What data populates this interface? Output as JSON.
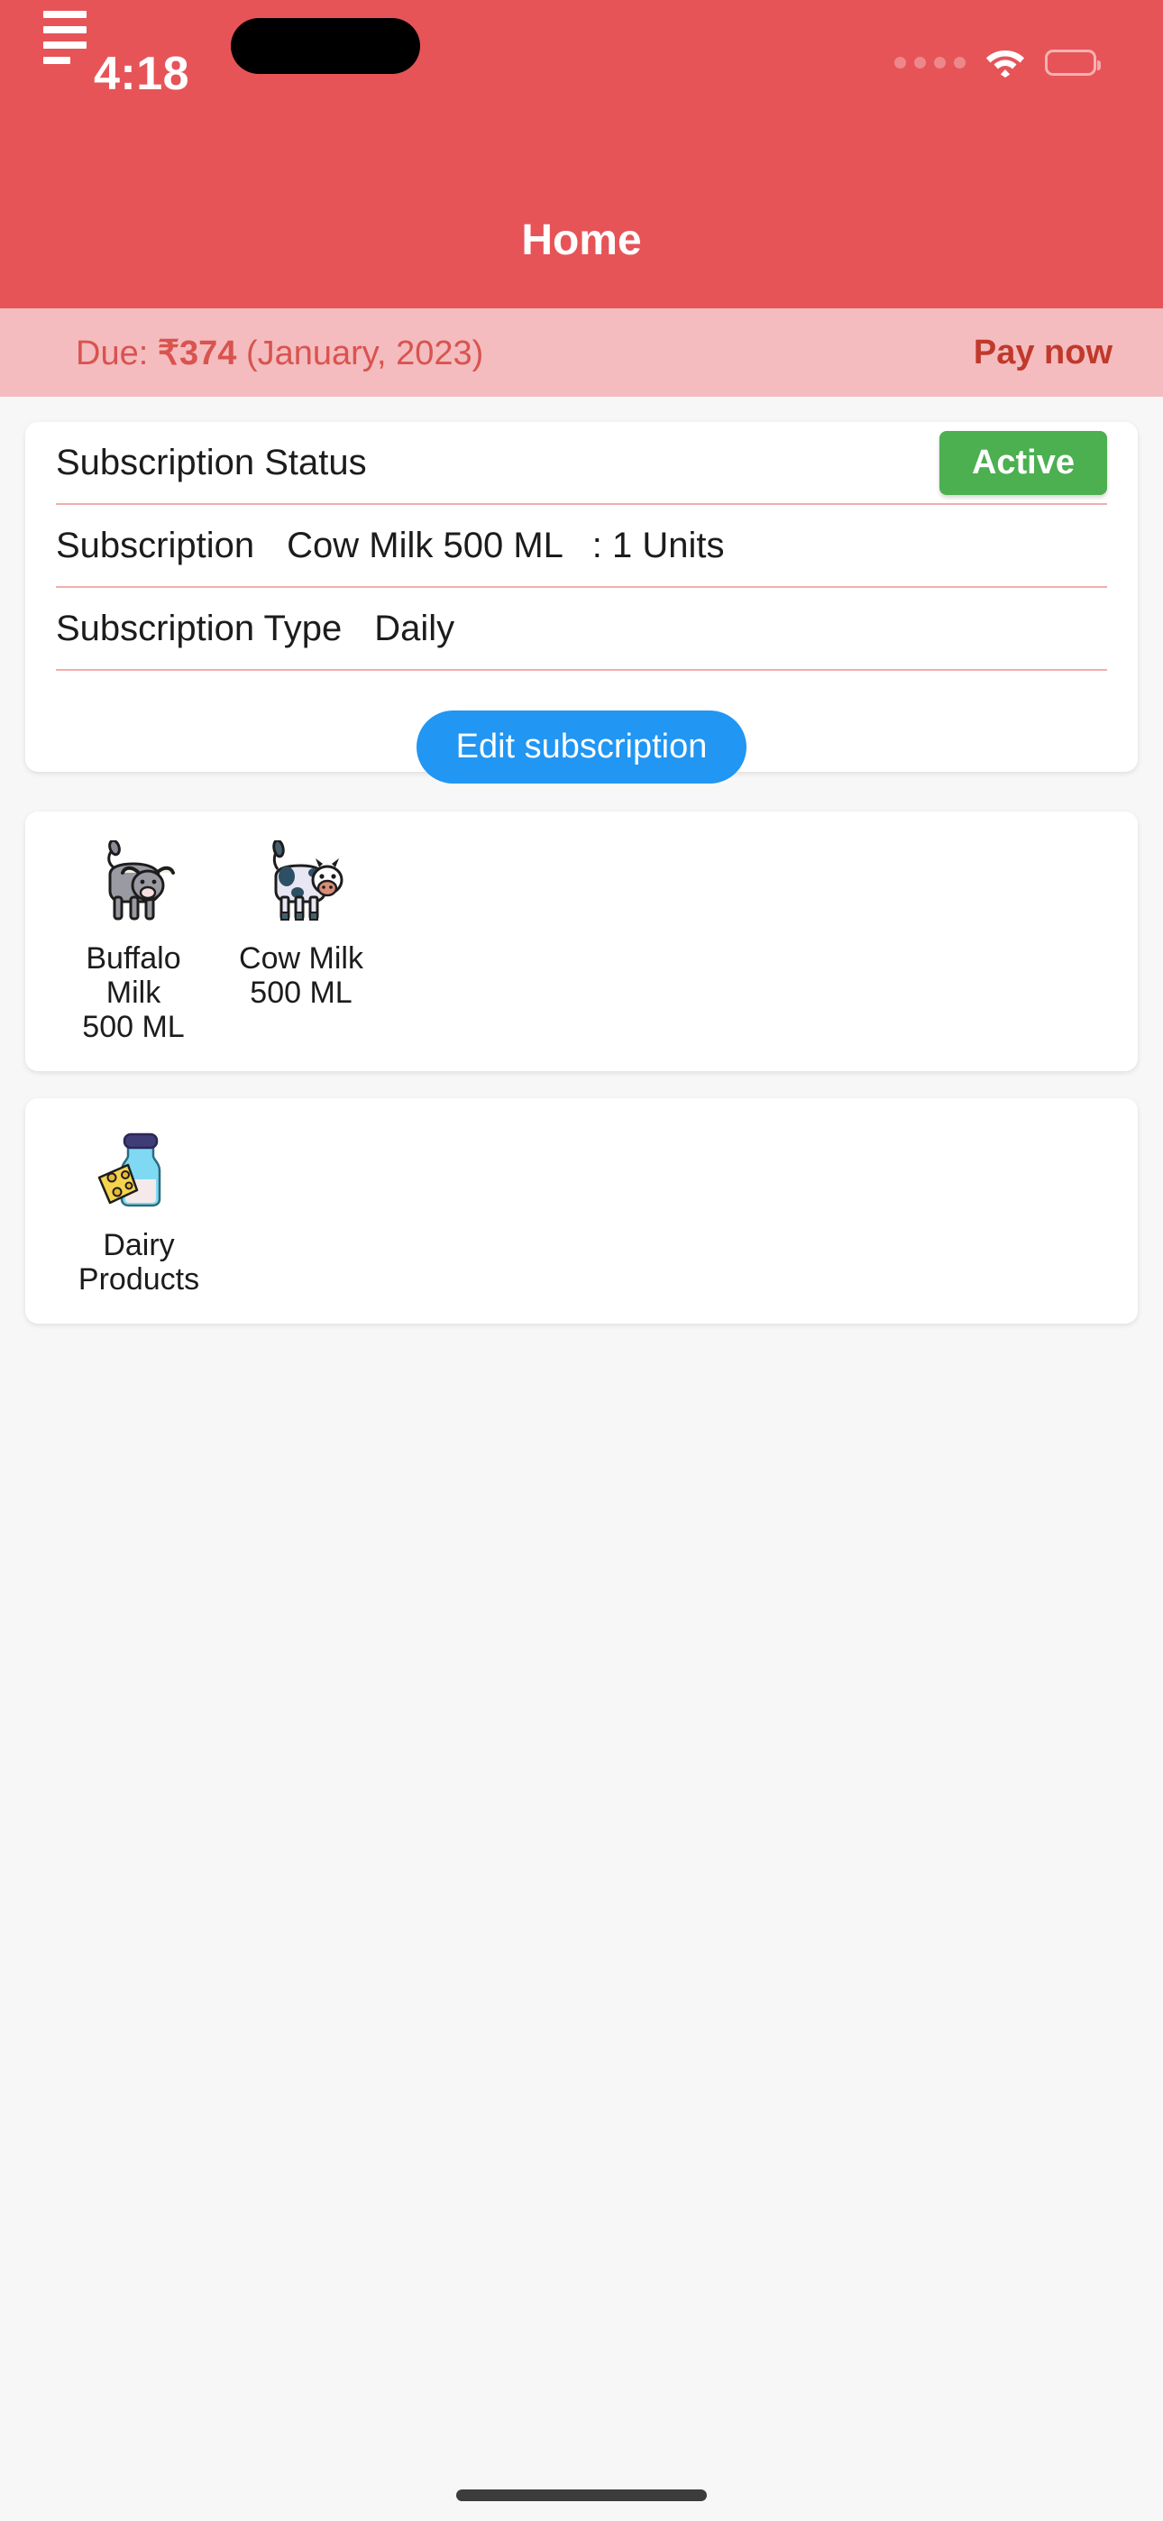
{
  "status_bar": {
    "time": "4:18",
    "signal_icon": "signal-dots-icon",
    "wifi_icon": "wifi-icon",
    "battery_icon": "battery-full-icon"
  },
  "app_bar": {
    "menu_icon": "hamburger-menu-icon",
    "title": "Home"
  },
  "due_banner": {
    "prefix": "Due: ",
    "amount": "₹374",
    "period": " (January, 2023)",
    "pay_label": "Pay now"
  },
  "subscription_card": {
    "rows": [
      {
        "label": "Subscription Status",
        "value": "",
        "badge": "Active"
      },
      {
        "label": "Subscription",
        "value": "Cow Milk 500 ML   : 1 Units",
        "badge": ""
      },
      {
        "label": "Subscription Type",
        "value": "Daily",
        "badge": ""
      }
    ],
    "edit_button": "Edit subscription"
  },
  "products_card": {
    "items": [
      {
        "icon": "buffalo-icon",
        "line1": "Buffalo Milk",
        "line2": "500 ML"
      },
      {
        "icon": "cow-icon",
        "line1": "Cow Milk",
        "line2": "500 ML"
      }
    ]
  },
  "dairy_card": {
    "items": [
      {
        "icon": "milk-bottle-cheese-icon",
        "line1": "Dairy",
        "line2": "Products"
      }
    ]
  },
  "colors": {
    "header_red": "#e65458",
    "banner_pink": "#f4bcbe",
    "due_text": "#d9534f",
    "active_green": "#4caf50",
    "edit_blue": "#2196f3",
    "divider_pink": "#f0aead",
    "page_bg": "#f7f7f7"
  }
}
